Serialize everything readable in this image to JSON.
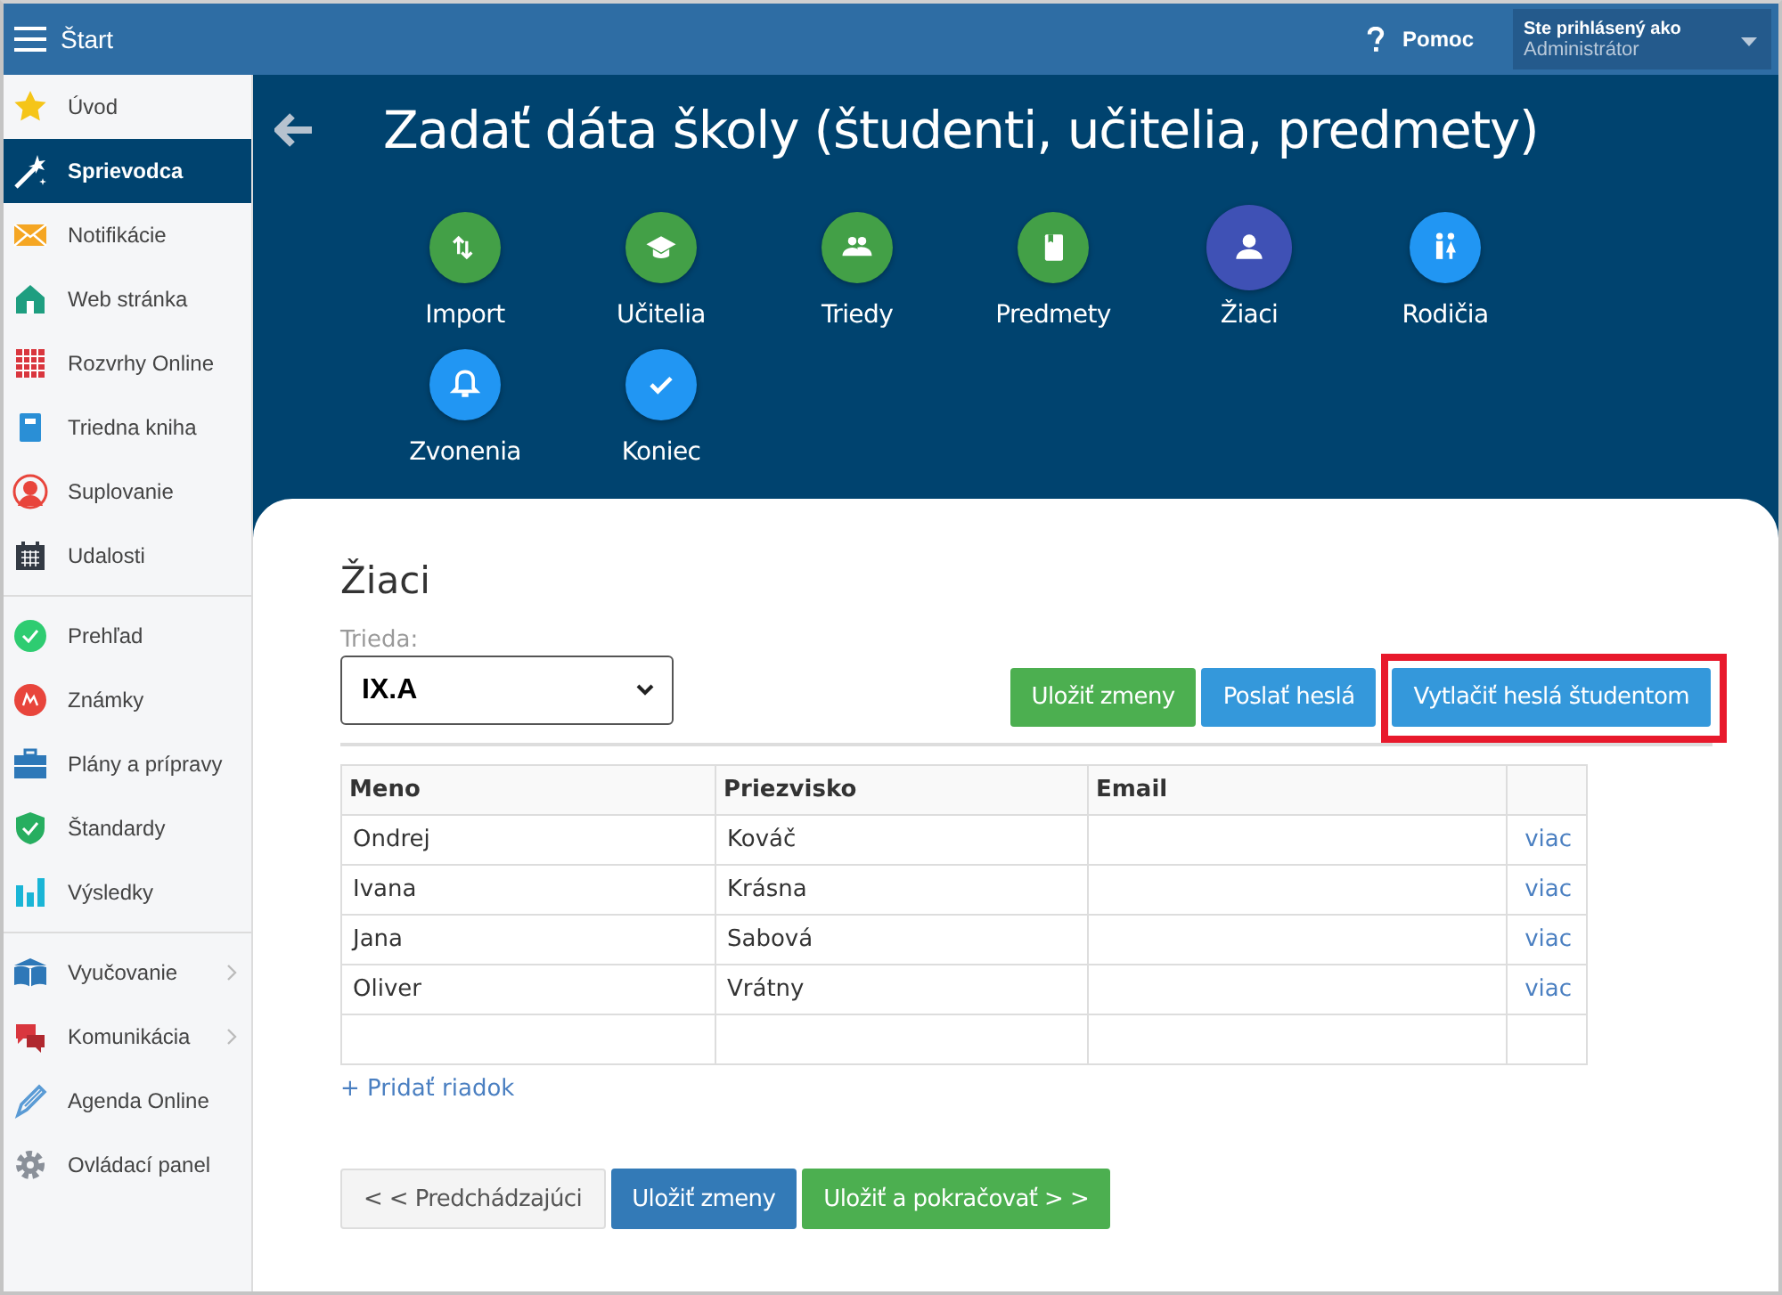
{
  "topbar": {
    "menu_title": "Štart",
    "help": "Pomoc",
    "user_label": "Ste prihlásený ako",
    "user_name": "Administrátor"
  },
  "sidebar": {
    "groups": [
      {
        "items": [
          {
            "label": "Úvod",
            "selected": false
          },
          {
            "label": "Sprievodca",
            "selected": true
          },
          {
            "label": "Notifikácie",
            "selected": false
          },
          {
            "label": "Web stránka",
            "selected": false
          },
          {
            "label": "Rozvrhy Online",
            "selected": false
          },
          {
            "label": "Triedna kniha",
            "selected": false
          },
          {
            "label": "Suplovanie",
            "selected": false
          },
          {
            "label": "Udalosti",
            "selected": false
          }
        ]
      },
      {
        "items": [
          {
            "label": "Prehľad",
            "selected": false
          },
          {
            "label": "Známky",
            "selected": false
          },
          {
            "label": "Plány a prípravy",
            "selected": false
          },
          {
            "label": "Štandardy",
            "selected": false
          },
          {
            "label": "Výsledky",
            "selected": false
          }
        ]
      },
      {
        "items": [
          {
            "label": "Vyučovanie",
            "selected": false,
            "has_submenu": true
          },
          {
            "label": "Komunikácia",
            "selected": false,
            "has_submenu": true
          },
          {
            "label": "Agenda Online",
            "selected": false,
            "has_submenu": false
          },
          {
            "label": "Ovládací panel",
            "selected": false,
            "has_submenu": false
          }
        ]
      }
    ]
  },
  "wizard": {
    "title": "Zadať dáta školy (študenti, učitelia, predmety)",
    "steps": [
      {
        "label": "Import",
        "color": "#43a047",
        "selected": false
      },
      {
        "label": "Učitelia",
        "color": "#43a047",
        "selected": false
      },
      {
        "label": "Triedy",
        "color": "#43a047",
        "selected": false
      },
      {
        "label": "Predmety",
        "color": "#43a047",
        "selected": false
      },
      {
        "label": "Žiaci",
        "color": "#3f51b5",
        "selected": true
      },
      {
        "label": "Rodičia",
        "color": "#2196f3",
        "selected": false
      },
      {
        "label": "Zvonenia",
        "color": "#2196f3",
        "selected": false
      },
      {
        "label": "Koniec",
        "color": "#2196f3",
        "selected": false
      }
    ]
  },
  "form": {
    "heading": "Žiaci",
    "class_label": "Trieda:",
    "class_value": "IX.A",
    "actions": [
      {
        "label": "Uložiť zmeny",
        "kind": "success",
        "highlighted": false
      },
      {
        "label": "Poslať heslá",
        "kind": "info",
        "highlighted": false
      },
      {
        "label": "Vytlačiť heslá študentom",
        "kind": "info",
        "highlighted": true
      }
    ],
    "table": {
      "columns": [
        "Meno",
        "Priezvisko",
        "Email"
      ],
      "rows": [
        {
          "first": "Ondrej",
          "last": "Kováč",
          "link": "viac"
        },
        {
          "first": "Ivana",
          "last": "Krásna",
          "link": "viac"
        },
        {
          "first": "Jana",
          "last": "Sabová",
          "link": "viac"
        },
        {
          "first": "Oliver",
          "last": "Vrátny",
          "link": "viac"
        }
      ]
    },
    "add_row": "+ Pridať riadok",
    "footer_buttons": [
      {
        "label": "< < Predchádzajúci",
        "kind": "default"
      },
      {
        "label": "Uložiť zmeny",
        "kind": "primary"
      },
      {
        "label": "Uložiť a pokračovať > >",
        "kind": "success"
      }
    ]
  }
}
